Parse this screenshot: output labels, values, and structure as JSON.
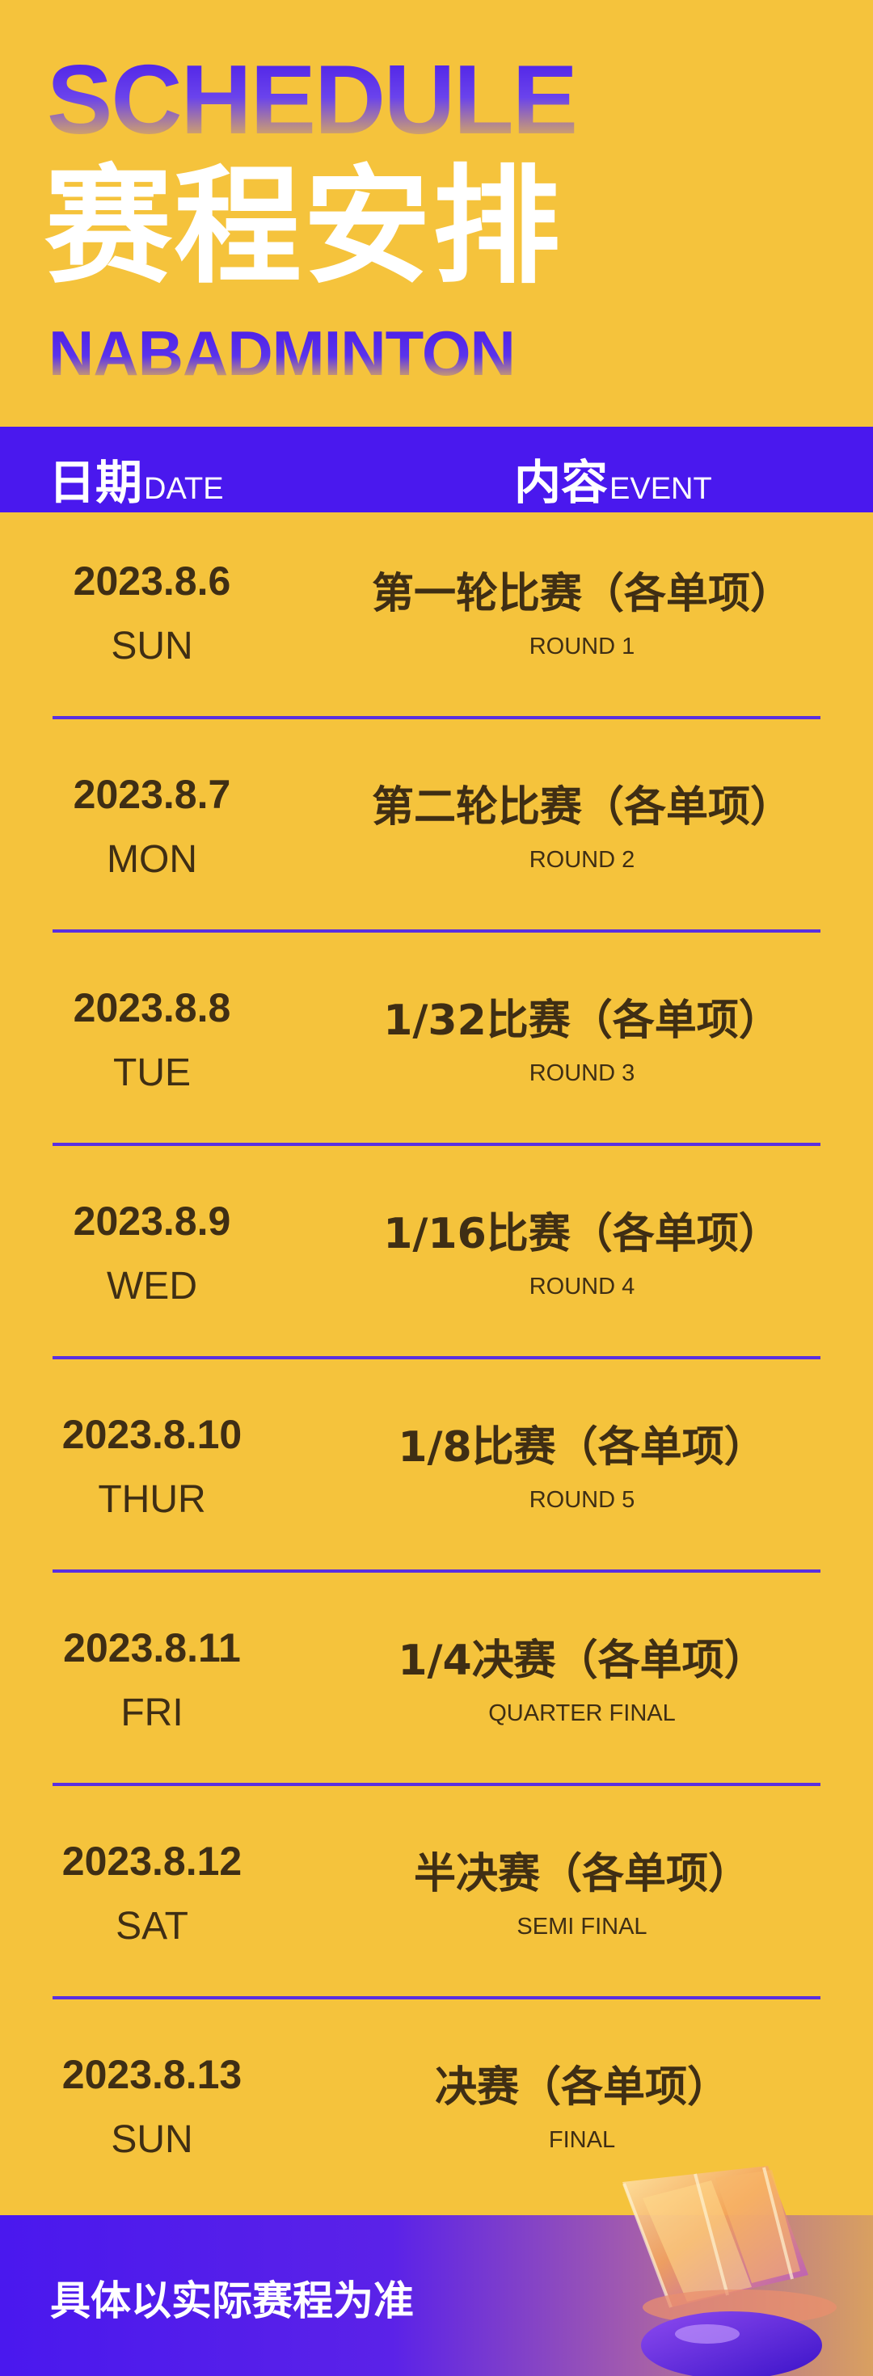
{
  "header": {
    "title_en": "SCHEDULE",
    "title_cn": "赛程安排",
    "brand": "NABADMINTON"
  },
  "columns": {
    "date_cn": "日期",
    "date_en": "DATE",
    "event_cn": "内容",
    "event_en": "EVENT"
  },
  "schedule": [
    {
      "date": "2023.8.6",
      "day": "SUN",
      "event": "第一轮比赛（各单项）",
      "round": "ROUND 1"
    },
    {
      "date": "2023.8.7",
      "day": "MON",
      "event": "第二轮比赛（各单项）",
      "round": "ROUND 2"
    },
    {
      "date": "2023.8.8",
      "day": "TUE",
      "event": "1/32比赛（各单项）",
      "round": "ROUND 3"
    },
    {
      "date": "2023.8.9",
      "day": "WED",
      "event": "1/16比赛（各单项）",
      "round": "ROUND 4"
    },
    {
      "date": "2023.8.10",
      "day": "THUR",
      "event": "1/8比赛（各单项）",
      "round": "ROUND 5"
    },
    {
      "date": "2023.8.11",
      "day": "FRI",
      "event": "1/4决赛（各单项）",
      "round": "QUARTER FINAL"
    },
    {
      "date": "2023.8.12",
      "day": "SAT",
      "event": "半决赛（各单项）",
      "round": "SEMI FINAL"
    },
    {
      "date": "2023.8.13",
      "day": "SUN",
      "event": "决赛（各单项）",
      "round": "FINAL"
    }
  ],
  "footer": {
    "note": "具体以实际赛程为准"
  },
  "colors": {
    "background": "#F5C33C",
    "accent": "#4A18EE",
    "text": "#3F2E14"
  }
}
